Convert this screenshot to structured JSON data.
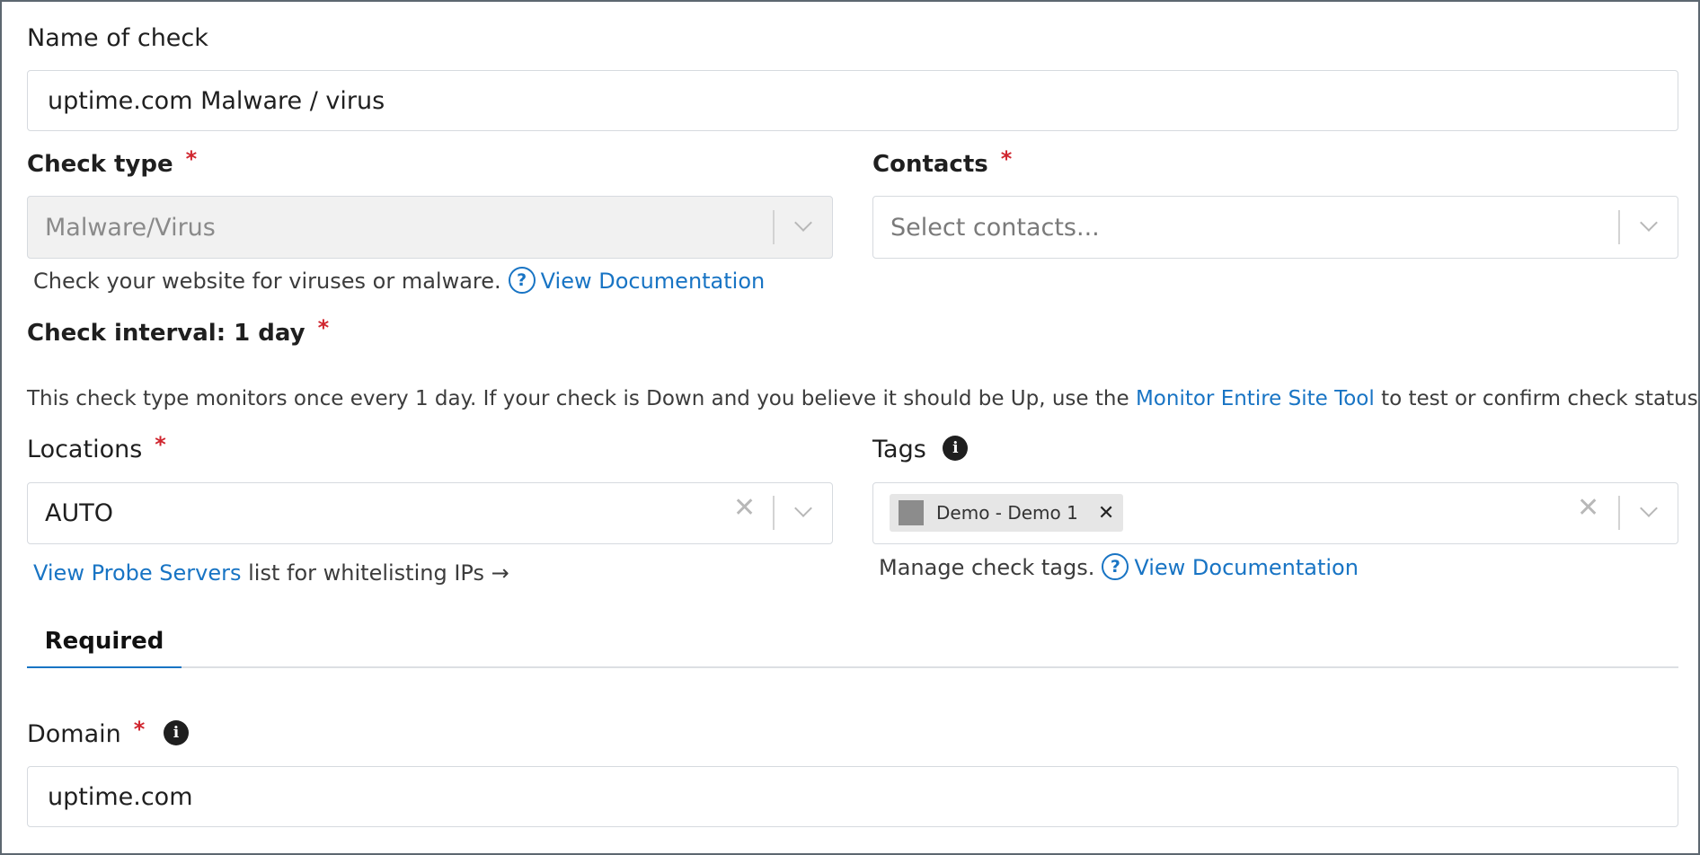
{
  "name_of_check": {
    "label": "Name of check",
    "value": "uptime.com Malware / virus"
  },
  "check_type": {
    "label": "Check type",
    "required_mark": "*",
    "value": "Malware/Virus",
    "help_text": "Check your website for viruses or malware.",
    "doc_link": "View Documentation"
  },
  "contacts": {
    "label": "Contacts",
    "required_mark": "*",
    "placeholder": "Select contacts..."
  },
  "check_interval": {
    "label": "Check interval: 1 day",
    "required_mark": "*",
    "desc_before": "This check type monitors once every 1 day. If your check is Down and you believe it should be Up, use the",
    "desc_link": "Monitor Entire Site Tool",
    "desc_after": "to test or confirm check status."
  },
  "locations": {
    "label": "Locations",
    "required_mark": "*",
    "value": "AUTO",
    "probe_link": "View Probe Servers",
    "probe_text": "list for whitelisting IPs →"
  },
  "tags": {
    "label": "Tags",
    "tag_chip": "Demo - Demo 1",
    "tag_color": "#8c8c8c",
    "help_text": "Manage check tags.",
    "doc_link": "View Documentation"
  },
  "tabs": [
    {
      "label": "Required",
      "active": true
    }
  ],
  "domain": {
    "label": "Domain",
    "required_mark": "*",
    "value": "uptime.com"
  },
  "colors": {
    "link": "#1874c4",
    "required": "#d0262f",
    "border": "#d6dadf",
    "disabled_bg": "#f1f1f1"
  },
  "icons": {
    "question": "?",
    "info": "i",
    "clear": "✕",
    "tag_remove": "✕"
  }
}
